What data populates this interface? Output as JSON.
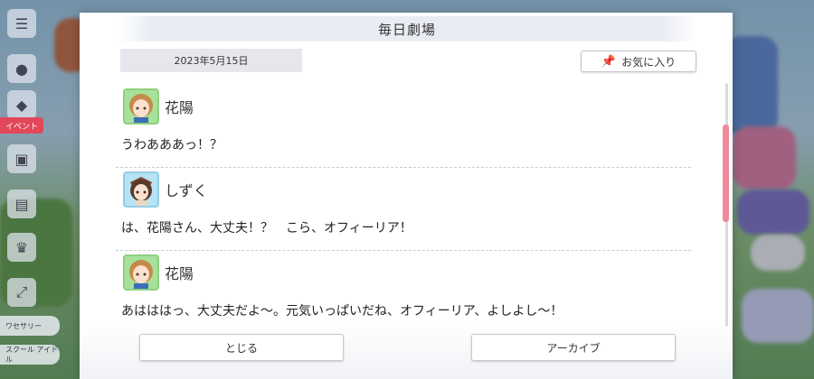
{
  "dialog": {
    "title": "毎日劇場",
    "date": "2023年5月15日",
    "favorite_label": "お気に入り",
    "favorite_icon": "pin-icon",
    "entries": [
      {
        "speaker": "花陽",
        "text": "うわあああっ！？",
        "avatar_color": "#a7e19a"
      },
      {
        "speaker": "しずく",
        "text": "は、花陽さん、大丈夫！？　こら、オフィーリア！",
        "avatar_color": "#b6e3f5"
      },
      {
        "speaker": "花陽",
        "text": "あはははっ、大丈夫だよ～。元気いっぱいだね、オフィーリア、よしよし～！",
        "avatar_color": "#a7e19a"
      }
    ],
    "close_label": "とじる",
    "archive_label": "アーカイブ"
  },
  "background": {
    "left_tag": "イベント",
    "left_label_1": "ワセサリー",
    "left_label_2": "スクール アイドル"
  },
  "colors": {
    "scroll_thumb": "#f08a9a",
    "accent_red": "#e2485a"
  }
}
